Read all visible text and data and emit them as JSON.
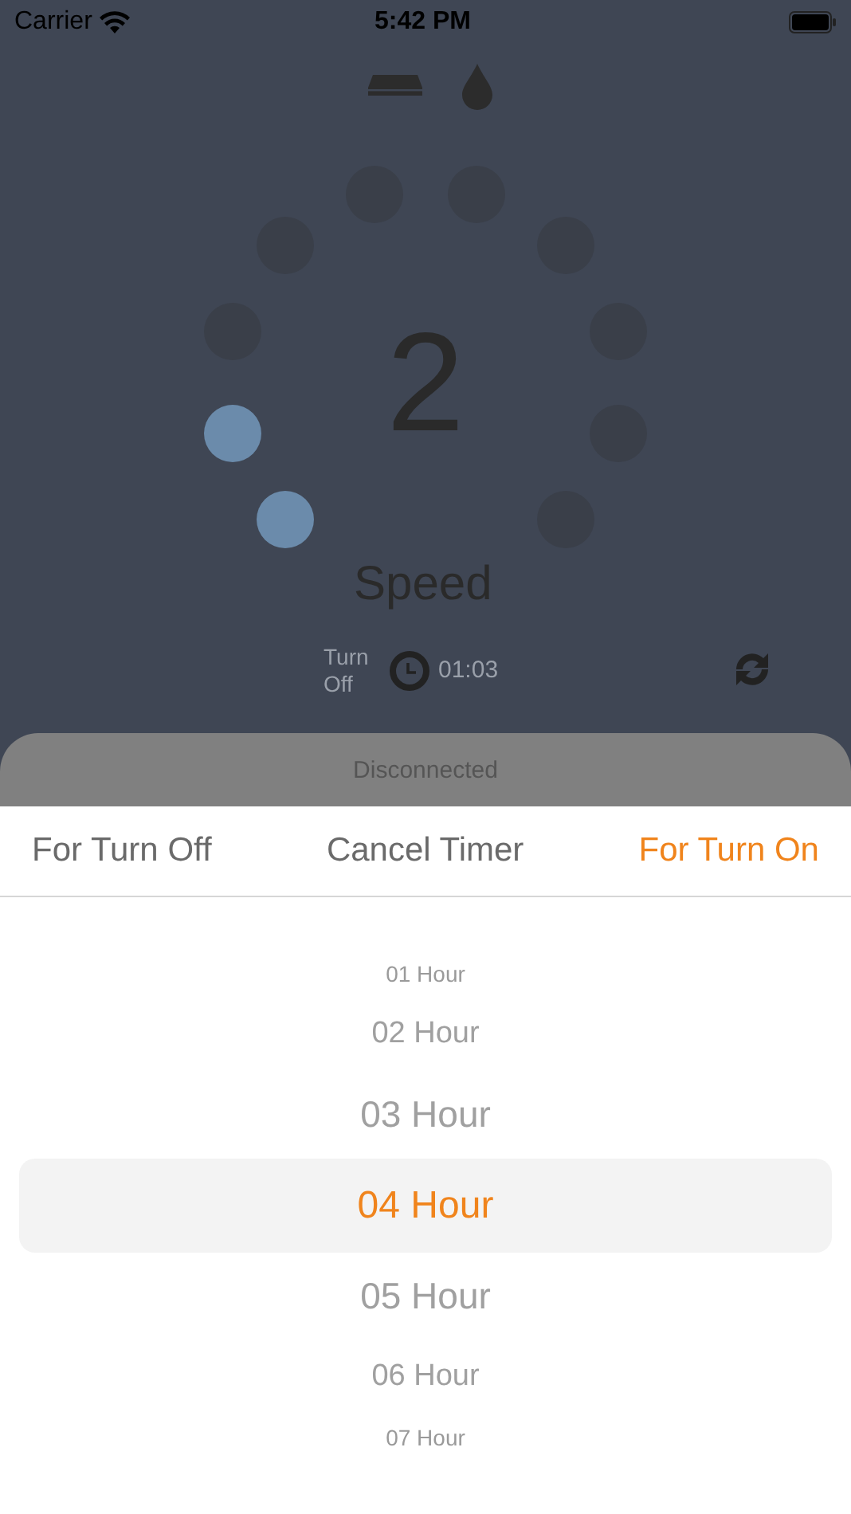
{
  "status_bar": {
    "carrier": "Carrier",
    "time": "5:42 PM"
  },
  "dial": {
    "value": "2",
    "label": "Speed",
    "dots": [
      {
        "active": true
      },
      {
        "active": true
      },
      {
        "active": false
      },
      {
        "active": false
      },
      {
        "active": false
      },
      {
        "active": false
      },
      {
        "active": false
      },
      {
        "active": false
      },
      {
        "active": false
      },
      {
        "active": false
      }
    ]
  },
  "timer": {
    "label": "Turn Off",
    "time": "01:03"
  },
  "connection_banner": "Disconnected",
  "tabs": [
    {
      "label": "For Turn Off",
      "selected": false
    },
    {
      "label": "Cancel Timer",
      "selected": false
    },
    {
      "label": "For Turn On",
      "selected": true
    }
  ],
  "picker": [
    {
      "label": "01 Hour",
      "selected": false
    },
    {
      "label": "02 Hour",
      "selected": false
    },
    {
      "label": "03 Hour",
      "selected": false
    },
    {
      "label": "04 Hour",
      "selected": true
    },
    {
      "label": "05 Hour",
      "selected": false
    },
    {
      "label": "06 Hour",
      "selected": false
    },
    {
      "label": "07 Hour",
      "selected": false
    }
  ]
}
